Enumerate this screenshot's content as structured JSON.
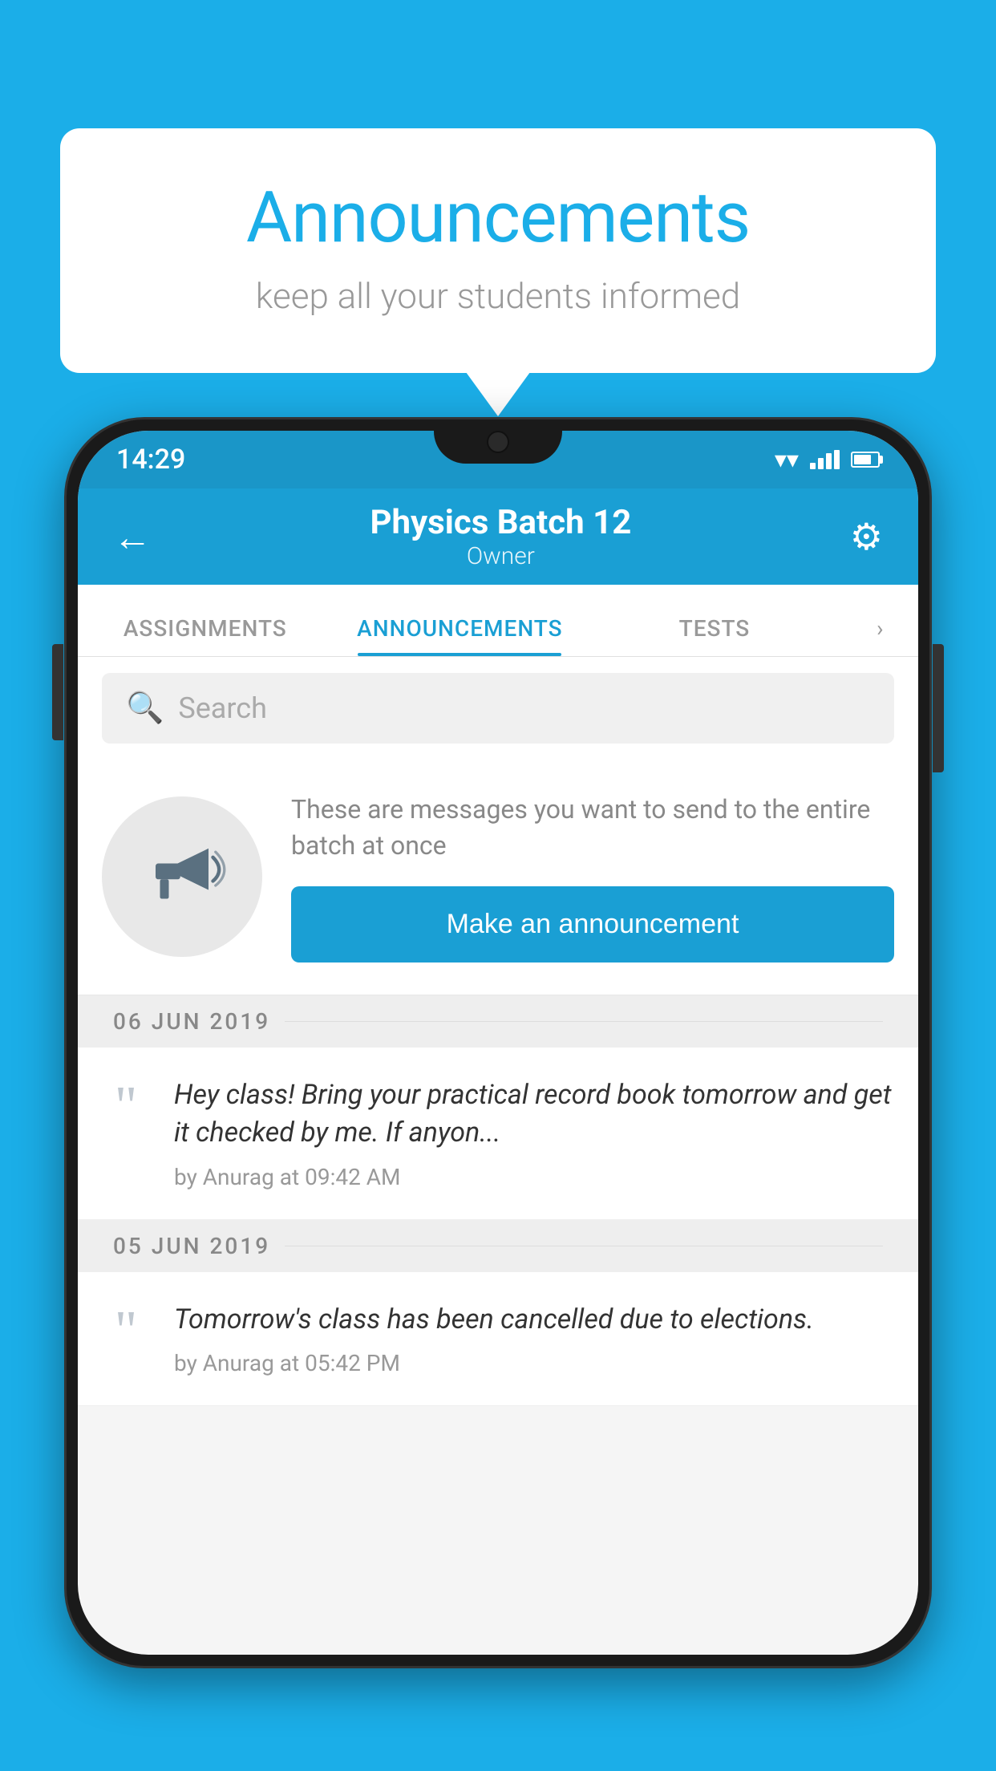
{
  "page": {
    "background_color": "#1BAEE8"
  },
  "speech_bubble": {
    "title": "Announcements",
    "subtitle": "keep all your students informed"
  },
  "phone": {
    "status_bar": {
      "time": "14:29"
    },
    "header": {
      "title": "Physics Batch 12",
      "subtitle": "Owner",
      "back_label": "←",
      "gear_label": "⚙"
    },
    "tabs": [
      {
        "label": "ASSIGNMENTS",
        "active": false
      },
      {
        "label": "ANNOUNCEMENTS",
        "active": true
      },
      {
        "label": "TESTS",
        "active": false
      }
    ],
    "search": {
      "placeholder": "Search"
    },
    "cta": {
      "description": "These are messages you want to send to the entire batch at once",
      "button_label": "Make an announcement"
    },
    "date_sections": [
      {
        "date": "06  JUN  2019",
        "announcements": [
          {
            "message": "Hey class! Bring your practical record book tomorrow and get it checked by me. If anyon...",
            "author": "by Anurag at 09:42 AM"
          }
        ]
      },
      {
        "date": "05  JUN  2019",
        "announcements": [
          {
            "message": "Tomorrow's class has been cancelled due to elections.",
            "author": "by Anurag at 05:42 PM"
          }
        ]
      }
    ]
  }
}
